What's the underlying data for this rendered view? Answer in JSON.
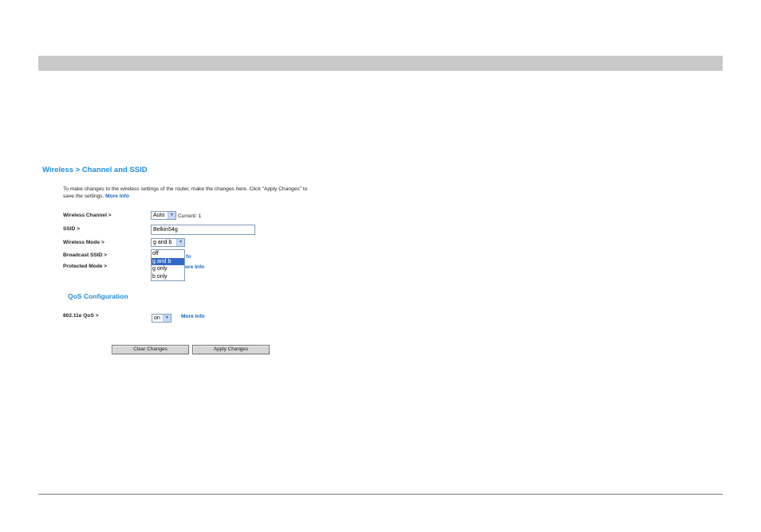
{
  "breadcrumb": "Wireless > Channel and SSID",
  "intro": {
    "text": "To make changes to the wireless settings of the router, make the changes here. Click \"Apply Changes\" to save the settings.",
    "more_info": "More Info"
  },
  "wireless_channel": {
    "label": "Wireless Channel >",
    "value": "Auto",
    "current": "Current: 1"
  },
  "ssid": {
    "label": "SSID >",
    "value": "Belkin54g"
  },
  "wireless_mode": {
    "label": "Wireless Mode >",
    "value": "g and b",
    "options": [
      "off",
      "g and b",
      "g only",
      "b only"
    ],
    "selected_index": 1
  },
  "broadcast_ssid": {
    "label": "Broadcast SSID >",
    "more_info_visible": "fo"
  },
  "protected_mode": {
    "label": "Protected Mode >",
    "more_info_visible": "ore Info"
  },
  "qos": {
    "section_title": "QoS Configuration",
    "label": "802.11e QoS >",
    "value": "on",
    "more_info": "More Info"
  },
  "buttons": {
    "clear": "Clear Changes",
    "apply": "Apply Changes"
  },
  "icons": {
    "select_arrow": "chevron-down-icon"
  },
  "colors": {
    "accent": "#1f8fd6",
    "link": "#1565c0",
    "top_bar": "#c8c8c8",
    "selection": "#316ac5"
  }
}
